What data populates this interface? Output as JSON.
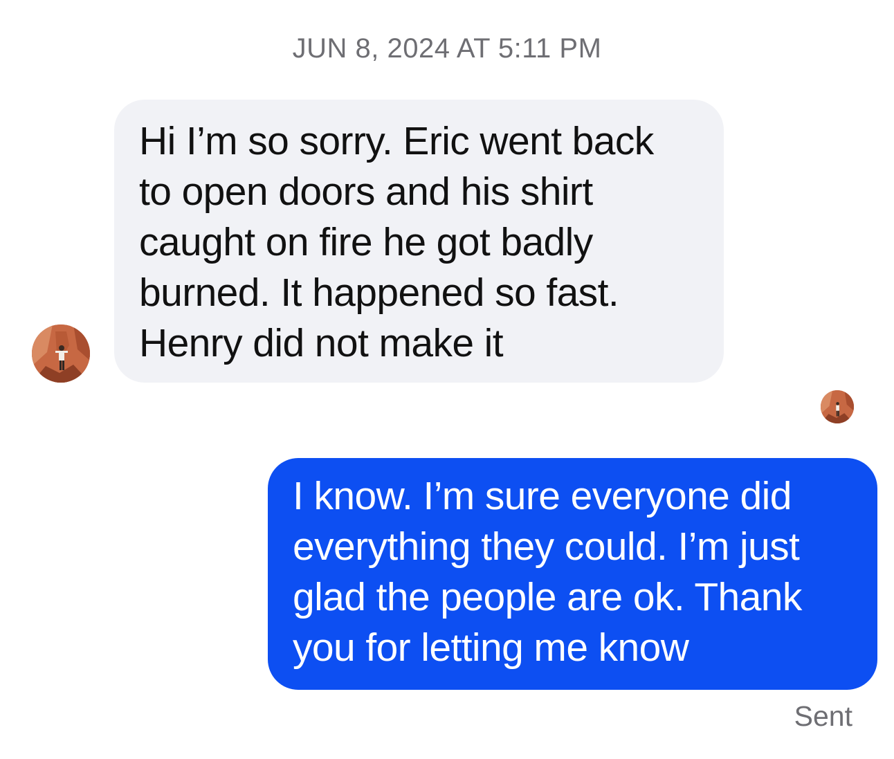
{
  "thread": {
    "timestamp": "JUN 8, 2024 AT 5:11 PM"
  },
  "messages": {
    "received": {
      "lines": [
        "Hi I’m so sorry. Eric went back",
        "to open doors and his shirt",
        "caught on fire he got badly",
        "burned. It happened so fast.",
        "Henry did not make it"
      ]
    },
    "sent": {
      "lines": [
        "I know. I’m sure everyone did",
        "everything they could. I’m just",
        "glad the people are ok. Thank",
        "you for letting me know"
      ],
      "status": "Sent"
    }
  },
  "colors": {
    "received_bubble": "#f1f2f6",
    "sent_bubble": "#0d4ff2",
    "meta_text": "#6e6e73"
  },
  "icons": {
    "contact_avatar": "contact-avatar-photo",
    "read_receipt_avatar": "read-receipt-avatar-photo"
  }
}
